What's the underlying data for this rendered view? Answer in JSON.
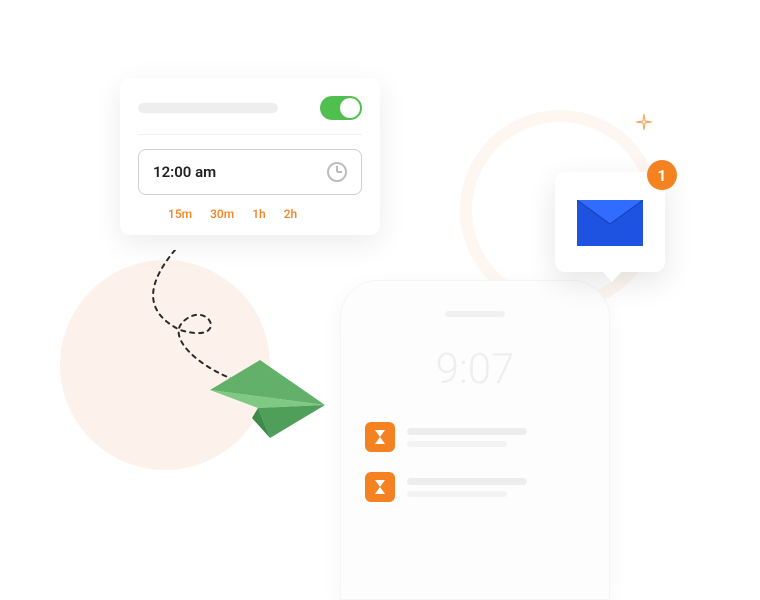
{
  "settings": {
    "time_value": "12:00 am",
    "chips": [
      "15m",
      "30m",
      "1h",
      "2h"
    ],
    "toggle_on": true
  },
  "phone": {
    "time": "9:07"
  },
  "envelope": {
    "badge_count": "1"
  },
  "colors": {
    "accent": "#f58220",
    "green": "#4fbf4f",
    "blue": "#1e52e0",
    "peach": "#fdf2eb"
  }
}
